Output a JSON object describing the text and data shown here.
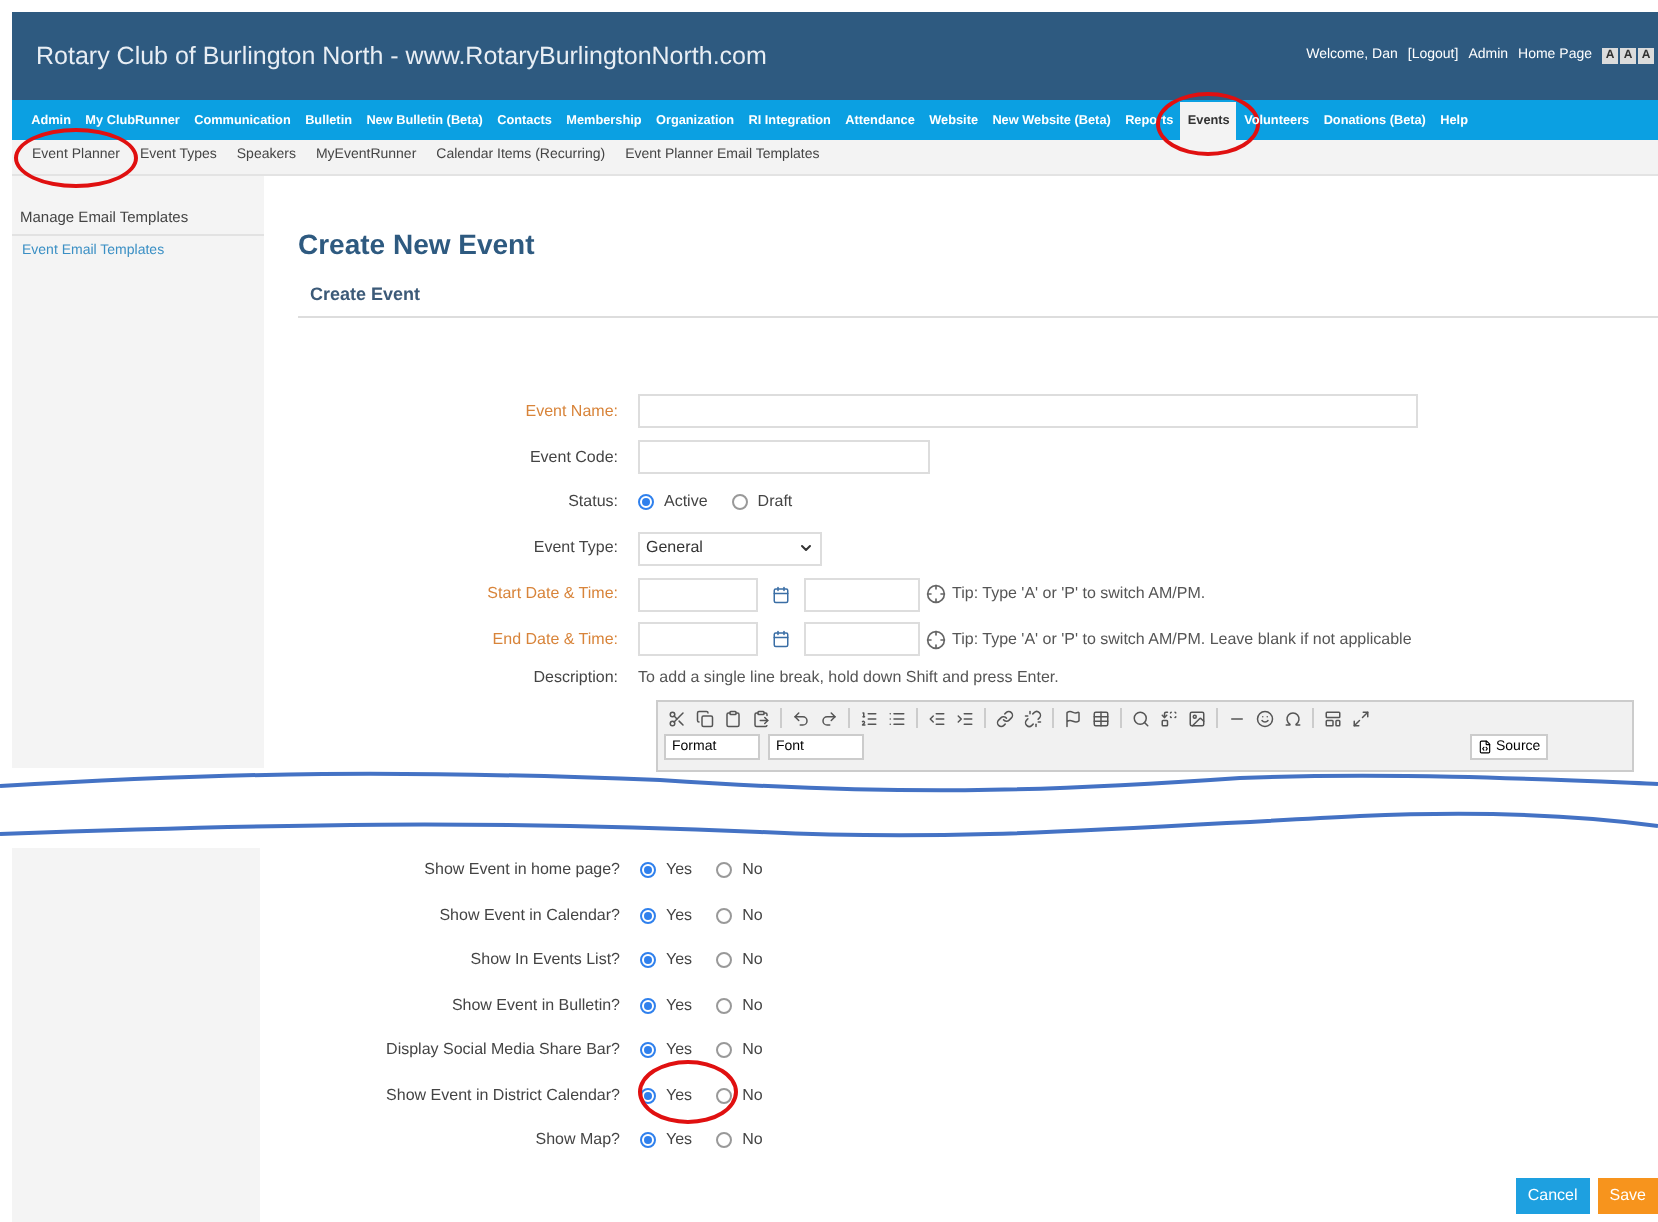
{
  "header": {
    "title": "Rotary Club of Burlington North - www.RotaryBurlingtonNorth.com",
    "welcome": "Welcome, Dan",
    "logout": "[Logout]",
    "links": [
      "Admin",
      "Home Page"
    ],
    "font_sizes": [
      "A",
      "A",
      "A"
    ]
  },
  "nav": [
    {
      "label": "Admin",
      "selected": false
    },
    {
      "label": "My ClubRunner",
      "selected": false
    },
    {
      "label": "Communication",
      "selected": false
    },
    {
      "label": "Bulletin",
      "selected": false
    },
    {
      "label": "New Bulletin (Beta)",
      "selected": false
    },
    {
      "label": "Contacts",
      "selected": false
    },
    {
      "label": "Membership",
      "selected": false
    },
    {
      "label": "Organization",
      "selected": false
    },
    {
      "label": "RI Integration",
      "selected": false
    },
    {
      "label": "Attendance",
      "selected": false
    },
    {
      "label": "Website",
      "selected": false
    },
    {
      "label": "New Website (Beta)",
      "selected": false
    },
    {
      "label": "Reports",
      "selected": false
    },
    {
      "label": "Events",
      "selected": true
    },
    {
      "label": "Volunteers",
      "selected": false
    },
    {
      "label": "Donations (Beta)",
      "selected": false
    },
    {
      "label": "Help",
      "selected": false
    }
  ],
  "subnav": [
    "Event Planner",
    "Event Types",
    "Speakers",
    "MyEventRunner",
    "Calendar Items (Recurring)",
    "Event Planner Email Templates"
  ],
  "sidebar": {
    "heading": "Manage Email Templates",
    "links": [
      "Event Email Templates"
    ]
  },
  "page_title": "Create New Event",
  "section_title": "Create Event",
  "fields": [
    {
      "kind": "text",
      "label": "Event Name:",
      "required": true,
      "wide": true
    },
    {
      "kind": "text",
      "label": "Event Code:",
      "required": false,
      "wide": false
    },
    {
      "kind": "radio",
      "label": "Status:",
      "required": false,
      "options": [
        {
          "label": "Active",
          "selected": true
        },
        {
          "label": "Draft",
          "selected": false
        }
      ]
    },
    {
      "kind": "select",
      "label": "Event Type:",
      "required": false,
      "value": "General"
    },
    {
      "kind": "datetime",
      "label": "Start Date & Time:",
      "required": true,
      "tip": "Tip: Type 'A' or 'P' to switch AM/PM."
    },
    {
      "kind": "datetime",
      "label": "End Date & Time:",
      "required": true,
      "tip": "Tip: Type 'A' or 'P' to switch AM/PM. Leave blank if not applicable"
    },
    {
      "kind": "description",
      "label": "Description:",
      "required": false,
      "hint": "To add a single line break, hold down Shift and press Enter."
    }
  ],
  "editor": {
    "format": "Format",
    "font": "Font",
    "source": "Source"
  },
  "options": [
    {
      "label": "Show Event in home page?",
      "yes": "Yes",
      "no": "No",
      "yes_selected": true
    },
    {
      "label": "Show Event in Calendar?",
      "yes": "Yes",
      "no": "No",
      "yes_selected": true
    },
    {
      "label": "Show In Events List?",
      "yes": "Yes",
      "no": "No",
      "yes_selected": true
    },
    {
      "label": "Show Event in Bulletin?",
      "yes": "Yes",
      "no": "No",
      "yes_selected": true
    },
    {
      "label": "Display Social Media Share Bar?",
      "yes": "Yes",
      "no": "No",
      "yes_selected": true
    },
    {
      "label": "Show Event in District Calendar?",
      "yes": "Yes",
      "no": "No",
      "yes_selected": true
    },
    {
      "label": "Show Map?",
      "yes": "Yes",
      "no": "No",
      "yes_selected": true
    }
  ],
  "buttons": [
    {
      "label": "Cancel",
      "kind": "secondary"
    },
    {
      "label": "Save",
      "kind": "primary"
    }
  ]
}
